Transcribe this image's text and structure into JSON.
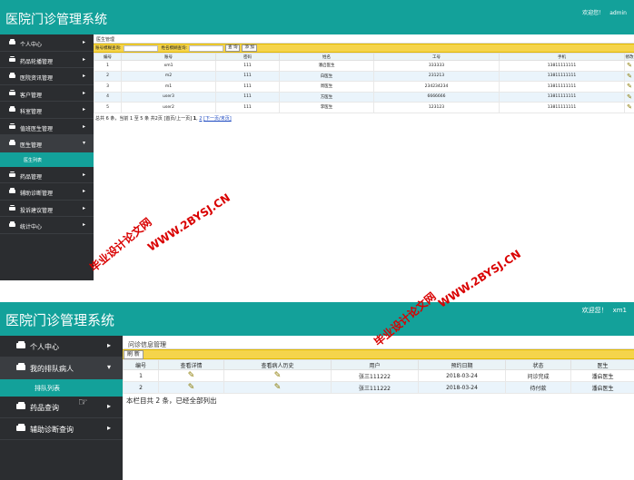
{
  "shot1": {
    "app_title": "医院门诊管理系统",
    "welcome": "欢迎您！",
    "user": "admin",
    "sidebar": [
      {
        "label": "个人中心",
        "expanded": false
      },
      {
        "label": "药品轮播管理",
        "expanded": false
      },
      {
        "label": "医院资讯管理",
        "expanded": false
      },
      {
        "label": "客户管理",
        "expanded": false
      },
      {
        "label": "科室管理",
        "expanded": false
      },
      {
        "label": "值班医生管理",
        "expanded": false
      },
      {
        "label": "医生管理",
        "expanded": true
      },
      {
        "label": "药品管理",
        "expanded": false
      },
      {
        "label": "辅助诊断管理",
        "expanded": false
      },
      {
        "label": "投诉建议管理",
        "expanded": false
      },
      {
        "label": "统计中心",
        "expanded": false
      }
    ],
    "sidebar_sub": "医生列表",
    "panel_title": "医生管理",
    "search": {
      "account_label": "账号模糊查询:",
      "name_label": "姓名模糊查询:",
      "query_button": "查 询",
      "add_button": "添 加"
    },
    "table": {
      "headers": [
        "编号",
        "账号",
        "密码",
        "姓名",
        "工号",
        "手机",
        "修改"
      ],
      "rows": [
        [
          "1",
          "xm1",
          "111",
          "潘启医生",
          "333333",
          "13811111111"
        ],
        [
          "2",
          "m2",
          "111",
          "白医生",
          "231213",
          "13811111111"
        ],
        [
          "3",
          "m1",
          "111",
          "周医生",
          "234234234",
          "13811111111"
        ],
        [
          "4",
          "user3",
          "111",
          "方医生",
          "6666666",
          "13811111111"
        ],
        [
          "5",
          "user2",
          "111",
          "李医生",
          "123123",
          "13811111111"
        ]
      ]
    },
    "pager": {
      "summary": "总共 6 条，当前 1 至 5 条 共2页 [首页/上一页]",
      "page1": "1",
      "sep": ",",
      "page2": "2",
      "next_link": "[下一页/末页]"
    }
  },
  "shot2": {
    "app_title": "医院门诊管理系统",
    "welcome": "欢迎您！",
    "user": "xm1",
    "sidebar": [
      {
        "label": "个人中心",
        "expanded": false
      },
      {
        "label": "我的排队病人",
        "expanded": true
      }
    ],
    "sidebar_sub": "排队列表",
    "sidebar_after": [
      {
        "label": "药品查询",
        "expanded": false
      },
      {
        "label": "辅助诊断查询",
        "expanded": false
      }
    ],
    "panel_title": "问诊信息管理",
    "toolbar": {
      "refresh_button": "刷 新"
    },
    "table": {
      "headers": [
        "编号",
        "查看详情",
        "查看病人历史",
        "用户",
        "预约日期",
        "状态",
        "医生"
      ],
      "rows": [
        [
          "1",
          "张三111222",
          "2018-03-24",
          "问诊完成",
          "潘启医生"
        ],
        [
          "2",
          "张三111222",
          "2018-03-24",
          "待付款",
          "潘启医生"
        ]
      ]
    },
    "pager": {
      "summary": "本栏目共 2 条，已经全部列出"
    }
  },
  "watermarks": {
    "site_cn": "毕业设计论文网",
    "site_url": "WWW.2BYSJ.CN"
  },
  "colors": {
    "header": "#13a19a",
    "sidebar": "#2b2d30",
    "toolbar": "#f5d44b",
    "watermark": "#d90000",
    "link": "#1a47c0"
  }
}
